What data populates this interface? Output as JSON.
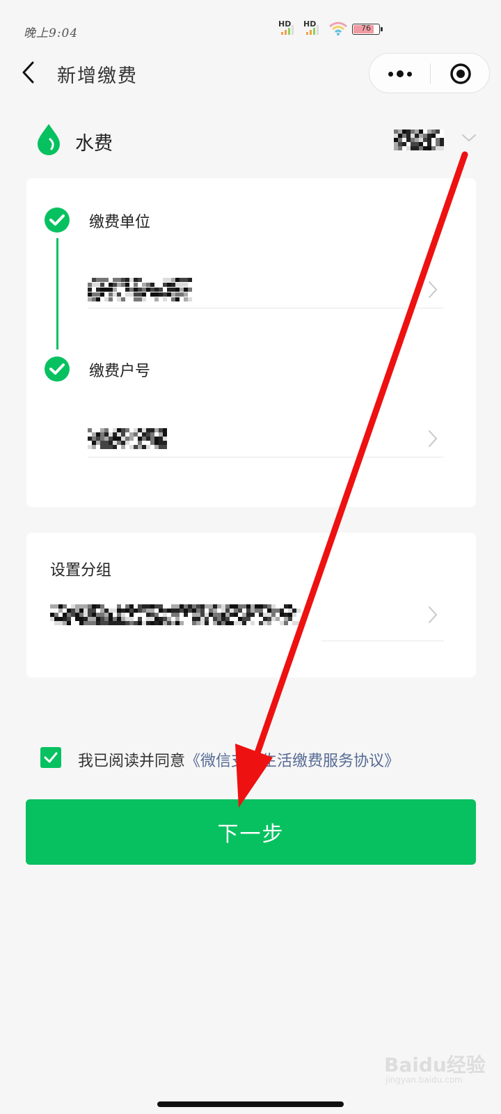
{
  "status_bar": {
    "time": "晚上9:04",
    "signal_1": "HD",
    "signal_2": "HD",
    "battery": "76"
  },
  "nav": {
    "title": "新增缴费",
    "more_icon": "more-dots-icon",
    "close_icon": "close-miniprogram-icon"
  },
  "bill": {
    "type_label": "水费",
    "type_icon": "water-drop-icon",
    "accent_color": "#07c160"
  },
  "steps": [
    {
      "label": "缴费单位",
      "icon": "check-circle-icon"
    },
    {
      "label": "缴费户号",
      "icon": "check-circle-icon"
    }
  ],
  "group": {
    "label": "设置分组"
  },
  "agreement": {
    "prefix": "我已阅读并同意",
    "link": "《微信支付生活缴费服务协议》",
    "checked": true
  },
  "next_button": {
    "label": "下一步"
  },
  "watermark": {
    "main": "Baidu经验",
    "sub": "jingyan.baidu.com"
  },
  "colors": {
    "primary": "#07c160",
    "link": "#576b95",
    "annotation_arrow": "#ee1111"
  }
}
